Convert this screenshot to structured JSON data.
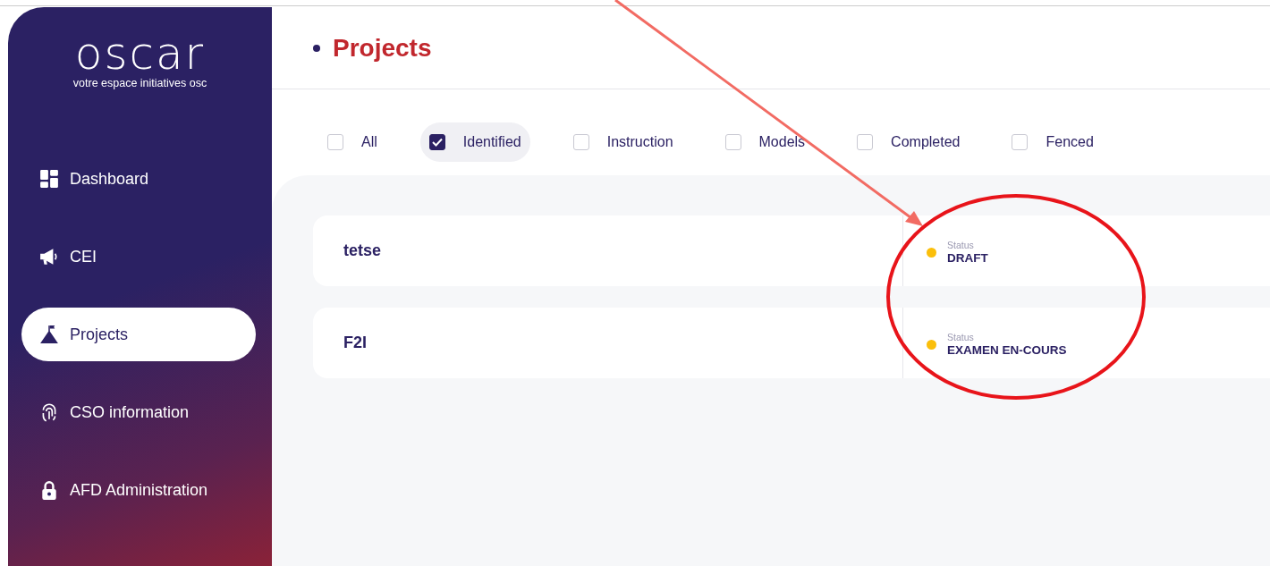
{
  "logo": {
    "name": "oscar",
    "tagline": "votre espace initiatives osc"
  },
  "sidebar": {
    "items": [
      {
        "label": "Dashboard",
        "selected": false
      },
      {
        "label": "CEI",
        "selected": false
      },
      {
        "label": "Projects",
        "selected": true
      },
      {
        "label": "CSO information",
        "selected": false
      },
      {
        "label": "AFD Administration",
        "selected": false
      }
    ]
  },
  "page_title": "Projects",
  "filters": [
    {
      "label": "All",
      "checked": false
    },
    {
      "label": "Identified",
      "checked": true
    },
    {
      "label": "Instruction",
      "checked": false
    },
    {
      "label": "Models",
      "checked": false
    },
    {
      "label": "Completed",
      "checked": false
    },
    {
      "label": "Fenced",
      "checked": false
    }
  ],
  "projects": [
    {
      "name": "tetse",
      "status_label": "Status",
      "status": "DRAFT",
      "color": "#fbbf0b"
    },
    {
      "name": "F2I",
      "status_label": "Status",
      "status": "EXAMEN EN-COURS",
      "color": "#fbbf0b"
    }
  ],
  "annotations": [
    {
      "kind": "arrow"
    },
    {
      "kind": "ellipse"
    }
  ]
}
